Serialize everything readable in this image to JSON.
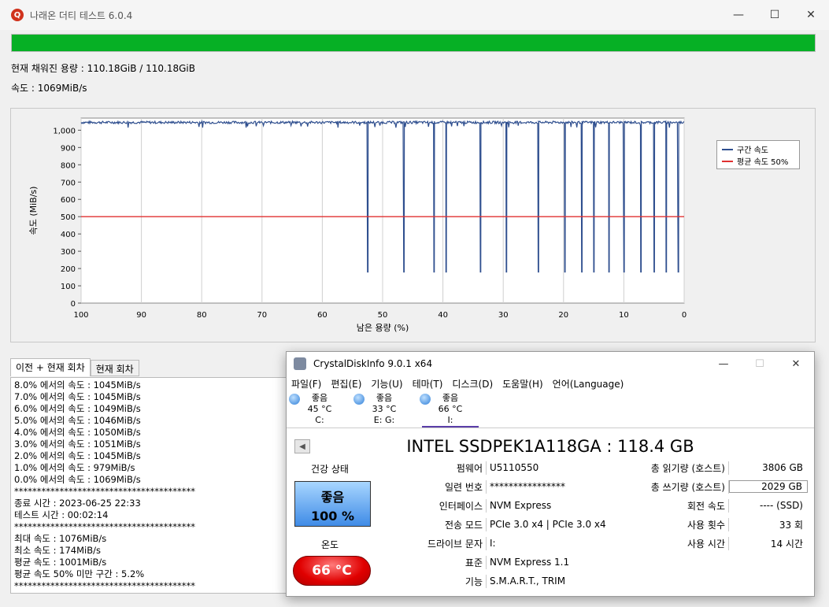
{
  "app": {
    "title": "나래온 더티 테스트 6.0.4",
    "icon_text": "Q",
    "progress_percent": 100,
    "filled_text": "현재 채워진 용량 : 110.18GiB / 110.18GiB",
    "speed_text": "속도 : 1069MiB/s",
    "win_minimize": "—",
    "win_maximize": "☐",
    "win_close": "✕"
  },
  "colors": {
    "progress_green": "#06b025",
    "series_line": "#2f4f8f",
    "avg_line": "#e03030"
  },
  "chart_data": {
    "type": "line",
    "xlabel": "남은 용량 (%)",
    "ylabel": "속도 (MiB/s)",
    "x_ticks": [
      "100",
      "90",
      "80",
      "70",
      "60",
      "50",
      "40",
      "30",
      "20",
      "10",
      "0"
    ],
    "y_ticks": [
      "0",
      "100",
      "200",
      "300",
      "400",
      "500",
      "600",
      "700",
      "800",
      "900",
      "1,000"
    ],
    "xlim": [
      100,
      0
    ],
    "ylim": [
      0,
      1070
    ],
    "grid": true,
    "legend_position": "right",
    "series": [
      {
        "name": "구간 속도",
        "baseline": 1045,
        "dips_x": [
          52.5,
          46.5,
          41.5,
          39.5,
          33.8,
          29.5,
          24.2,
          19.8,
          17.0,
          15.0,
          12.5,
          10.0,
          7.2,
          5.0,
          3.0,
          1.0
        ],
        "dip_value": 180
      },
      {
        "name": "평균 속도 50%",
        "values": [
          500,
          500
        ]
      }
    ]
  },
  "tabs": [
    "이전 + 현재 회차",
    "현재 회차"
  ],
  "log": [
    "8.0% 에서의 속도 : 1045MiB/s",
    "7.0% 에서의 속도 : 1045MiB/s",
    "6.0% 에서의 속도 : 1049MiB/s",
    "5.0% 에서의 속도 : 1046MiB/s",
    "4.0% 에서의 속도 : 1050MiB/s",
    "3.0% 에서의 속도 : 1051MiB/s",
    "2.0% 에서의 속도 : 1045MiB/s",
    "1.0% 에서의 속도 : 979MiB/s",
    "0.0% 에서의 속도 : 1069MiB/s",
    "****************************************",
    "종료 시간 : 2023-06-25 22:33",
    "테스트 시간 : 00:02:14",
    "****************************************",
    "최대 속도 : 1076MiB/s",
    "최소 속도 : 174MiB/s",
    "평균 속도 : 1001MiB/s",
    "평균 속도 50% 미만 구간 : 5.2%",
    "****************************************"
  ],
  "cdi": {
    "title": "CrystalDiskInfo 9.0.1 x64",
    "menu": [
      "파일(F)",
      "편집(E)",
      "기능(U)",
      "테마(T)",
      "디스크(D)",
      "도움말(H)",
      "언어(Language)"
    ],
    "disks": [
      {
        "status": "좋음",
        "temp": "45 °C",
        "letter": "C:"
      },
      {
        "status": "좋음",
        "temp": "33 °C",
        "letter": "E: G:"
      },
      {
        "status": "좋음",
        "temp": "66 °C",
        "letter": "I:"
      }
    ],
    "model": "INTEL SSDPEK1A118GA : 118.4 GB",
    "back_arrow": "◀",
    "health_label": "건강 상태",
    "health_status": "좋음",
    "health_percent": "100 %",
    "temp_label": "온도",
    "temp_value": "66 °C",
    "left_fields": [
      {
        "k": "펌웨어",
        "v": "U5110550"
      },
      {
        "k": "일련 번호",
        "v": "****************"
      },
      {
        "k": "인터페이스",
        "v": "NVM Express"
      },
      {
        "k": "전송 모드",
        "v": "PCIe 3.0 x4 | PCIe 3.0 x4"
      },
      {
        "k": "드라이브 문자",
        "v": "I:"
      },
      {
        "k": "표준",
        "v": "NVM Express 1.1"
      },
      {
        "k": "기능",
        "v": "S.M.A.R.T., TRIM"
      }
    ],
    "right_fields": [
      {
        "k": "총 읽기량 (호스트)",
        "v": "3806 GB"
      },
      {
        "k": "총 쓰기량 (호스트)",
        "v": "2029 GB"
      },
      {
        "k": "회전 속도",
        "v": "---- (SSD)"
      },
      {
        "k": "사용 횟수",
        "v": "33 회"
      },
      {
        "k": "사용 시간",
        "v": "14 시간"
      }
    ]
  }
}
